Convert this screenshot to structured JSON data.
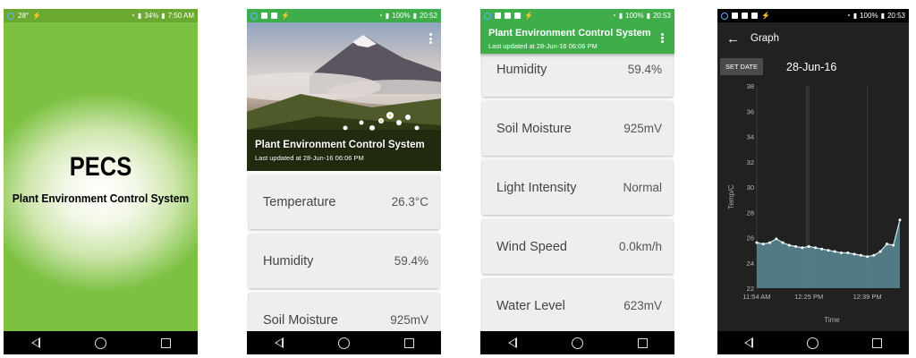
{
  "splash": {
    "status": {
      "left": "28°",
      "right_battery": "34%",
      "time": "7:50 AM"
    },
    "title": "PECS",
    "subtitle": "Plant Environment Control System"
  },
  "main_screen": {
    "status": {
      "battery": "100%",
      "time": "20:52"
    },
    "title": "Plant Environment Control System",
    "subtitle": "Last updated at 28-Jun-16 06:06 PM",
    "cards": [
      {
        "label": "Temperature",
        "value": "26.3°C"
      },
      {
        "label": "Humidity",
        "value": "59.4%"
      },
      {
        "label": "Soil Moisture",
        "value": "925mV"
      }
    ]
  },
  "scrolled_screen": {
    "status": {
      "battery": "100%",
      "time": "20:53"
    },
    "title": "Plant Environment Control System",
    "subtitle": "Last updated at 28-Jun-16 06:06 PM",
    "cards": [
      {
        "label": "Humidity",
        "value": "59.4%"
      },
      {
        "label": "Soil Moisture",
        "value": "925mV"
      },
      {
        "label": "Light Intensity",
        "value": "Normal"
      },
      {
        "label": "Wind Speed",
        "value": "0.0km/h"
      },
      {
        "label": "Water Level",
        "value": "623mV"
      }
    ]
  },
  "graph_screen": {
    "status": {
      "battery": "100%",
      "time": "20:53"
    },
    "title": "Graph",
    "set_date_label": "SET DATE",
    "date": "28-Jun-16"
  },
  "colors": {
    "green_primary": "#3fae4a",
    "splash_green": "#7cc142",
    "graph_fill": "#5a8a95",
    "graph_line": "#cfe8ee"
  },
  "chart_data": {
    "type": "area",
    "title": "",
    "xlabel": "Time",
    "ylabel": "Temp/C",
    "ylim": [
      22,
      38
    ],
    "y_ticks": [
      22,
      24,
      26,
      28,
      30,
      32,
      34,
      36,
      38
    ],
    "x_ticks": [
      "11:54 AM",
      "12:25 PM",
      "12:39 PM"
    ],
    "x": [
      0,
      1,
      2,
      3,
      4,
      5,
      6,
      7,
      8,
      9,
      10,
      11,
      12,
      13,
      14,
      15,
      16,
      17,
      18,
      19,
      20,
      21,
      22
    ],
    "values": [
      25.6,
      25.5,
      25.6,
      25.9,
      25.6,
      25.4,
      25.3,
      25.2,
      25.3,
      25.2,
      25.1,
      25.0,
      24.9,
      24.8,
      24.8,
      24.7,
      24.6,
      24.5,
      24.6,
      24.9,
      25.5,
      25.4,
      27.4
    ],
    "grid": true
  }
}
